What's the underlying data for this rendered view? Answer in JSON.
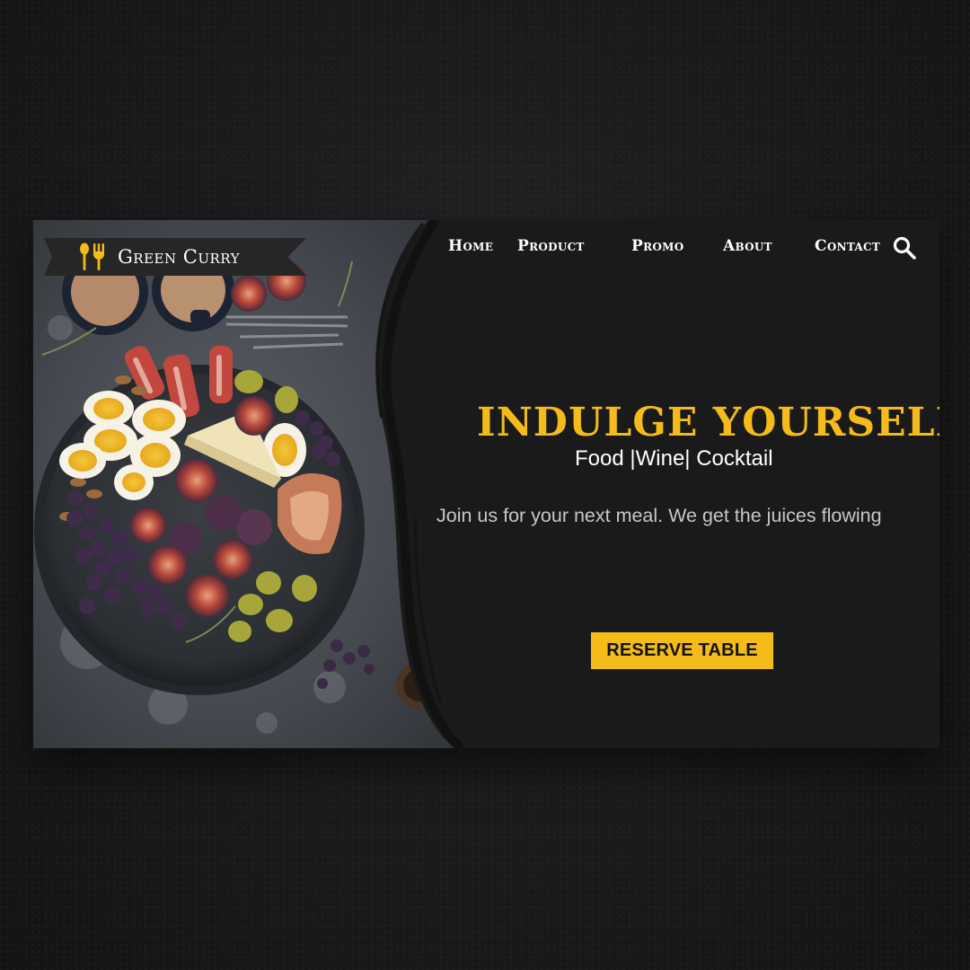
{
  "brand": {
    "name": "Green Curry",
    "icon": "fork-spoon-icon"
  },
  "nav": {
    "items": [
      "Home",
      "Product",
      "Promo",
      "About",
      "Contact"
    ],
    "search_icon": "search-icon"
  },
  "hero": {
    "headline": "INDULGE YOURSELF",
    "subhead": "Food |Wine| Cocktail",
    "tagline": "Join us for your next meal. We get the juices flowing",
    "cta_label": "RESERVE TABLE"
  },
  "colors": {
    "accent": "#f5bc19",
    "panel": "#1a1a1b",
    "text": "#ffffff",
    "muted_text": "#c7c7c7"
  }
}
